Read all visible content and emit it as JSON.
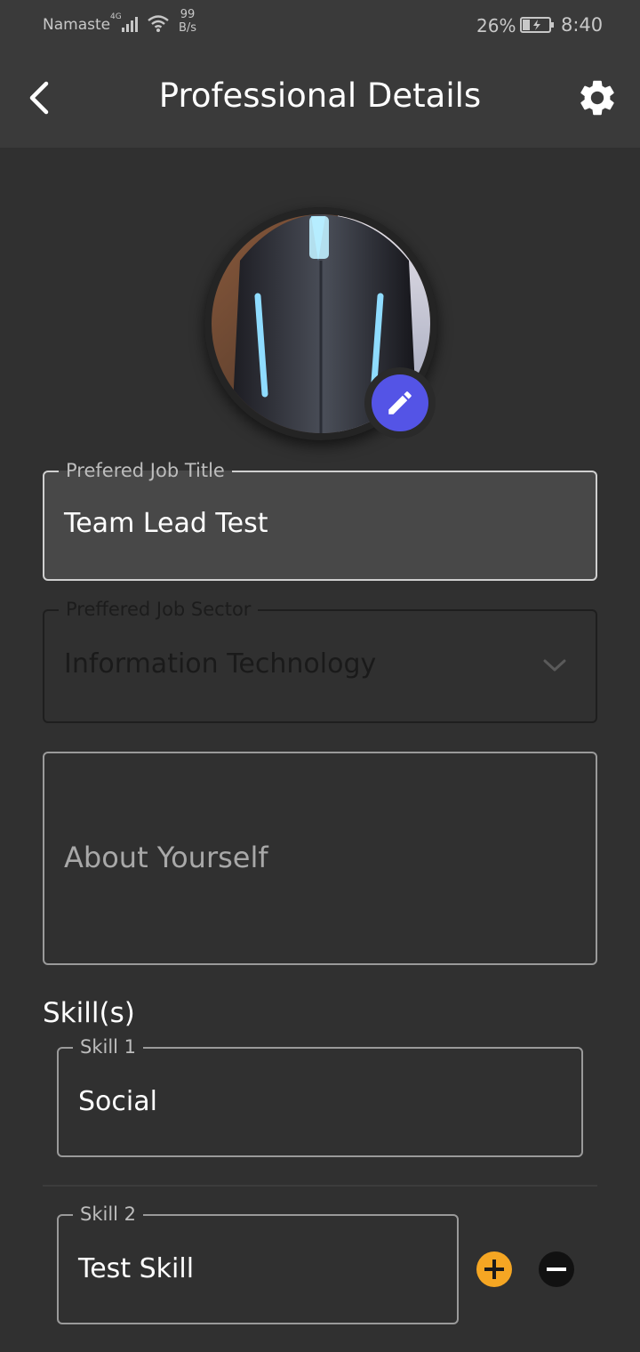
{
  "status_bar": {
    "carrier": "Namaste",
    "network_type": "4G",
    "net_speed_value": "99",
    "net_speed_unit": "B/s",
    "battery_percent": "26%",
    "time": "8:40"
  },
  "app_bar": {
    "title": "Professional Details",
    "back_icon": "chevron-left-icon",
    "settings_icon": "gear-icon"
  },
  "profile": {
    "edit_icon": "pencil-icon",
    "edit_button_color": "#5454e6"
  },
  "form": {
    "job_title": {
      "label": "Prefered Job Title",
      "value": "Team Lead Test"
    },
    "job_sector": {
      "label": "Preffered Job Sector",
      "value": "Information Technology"
    },
    "about": {
      "placeholder": "About Yourself"
    },
    "skills_heading": "Skill(s)",
    "skills": [
      {
        "label": "Skill 1",
        "value": "Social"
      },
      {
        "label": "Skill 2",
        "value": "Test Skill"
      }
    ],
    "add_color": "#f5a623",
    "remove_color": "#111111"
  }
}
